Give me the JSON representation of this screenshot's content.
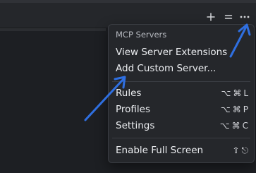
{
  "toolbar": {
    "icons": [
      "plus-icon",
      "new-tab-icon",
      "more-icon"
    ]
  },
  "menu": {
    "header": "MCP Servers",
    "items": [
      {
        "label": "View Server Extensions"
      },
      {
        "label": "Add Custom Server..."
      },
      {
        "label": "Rules",
        "shortcut": [
          "⌥",
          "⌘",
          "L"
        ]
      },
      {
        "label": "Profiles",
        "shortcut": [
          "⌥",
          "⌘",
          "P"
        ]
      },
      {
        "label": "Settings",
        "shortcut": [
          "⌥",
          "⌘",
          "C"
        ]
      },
      {
        "label": "Enable Full Screen",
        "shortcut": [
          "⇧",
          "⎋"
        ]
      }
    ]
  },
  "colors": {
    "background": "#1d1f23",
    "menu_bg": "#25272b",
    "annotation_arrow": "#2f6fe0"
  }
}
